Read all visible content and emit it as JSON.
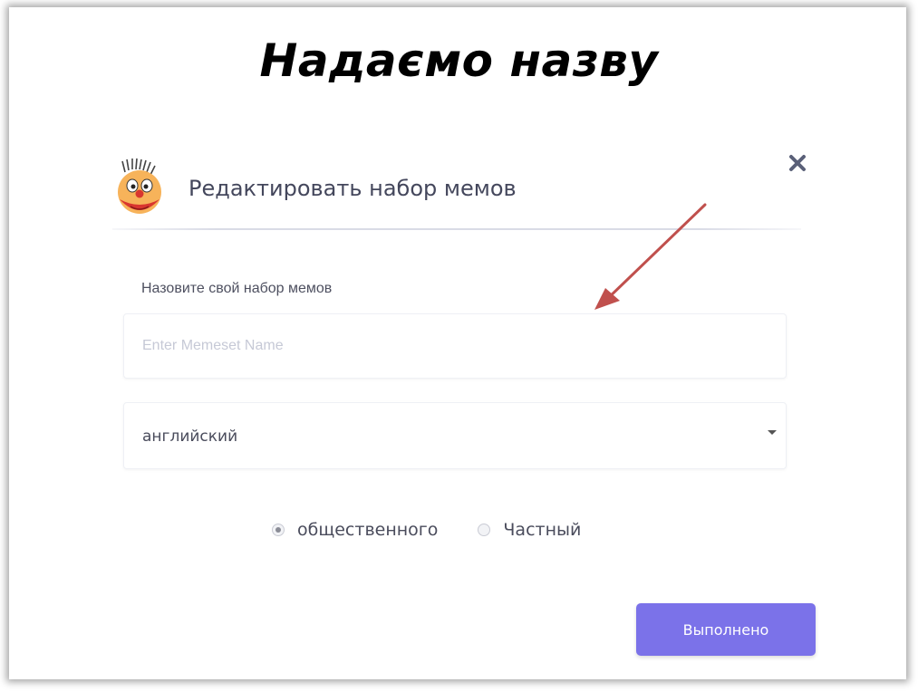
{
  "slide": {
    "title": "Надаємо назву"
  },
  "dialog": {
    "title": "Редактировать набор мемов",
    "close_icon": "close-icon",
    "logo_icon": "clown-face-icon"
  },
  "form": {
    "name_label": "Назовите свой набор мемов",
    "name_input": {
      "value": "",
      "placeholder": "Enter Memeset Name"
    },
    "language_select": {
      "selected": "английский",
      "icon": "caret-down-icon"
    },
    "visibility": {
      "options": [
        {
          "label": "общественного",
          "checked": true
        },
        {
          "label": "Частный",
          "checked": false
        }
      ]
    },
    "submit_label": "Выполнено"
  },
  "annotation": {
    "arrow_color": "#c0504d"
  },
  "colors": {
    "accent": "#7b72e9",
    "title_text": "#44475c",
    "close_icon": "#5a6078"
  }
}
